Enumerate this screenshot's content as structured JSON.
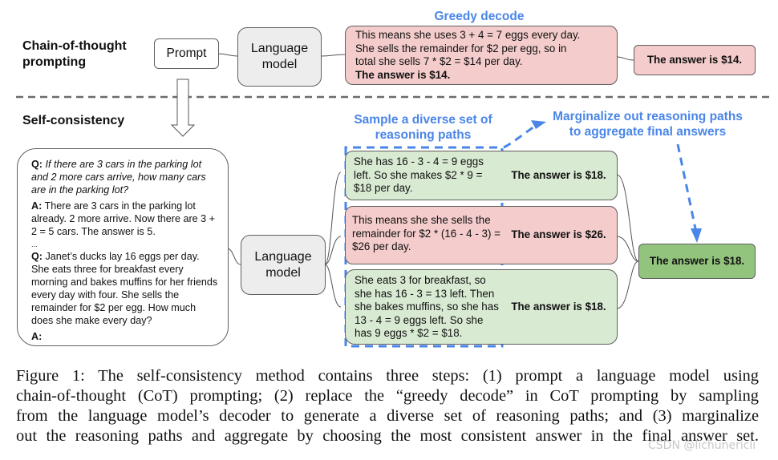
{
  "top": {
    "section_label_line1": "Chain-of-thought",
    "section_label_line2": "prompting",
    "prompt_box": "Prompt",
    "lm_line1": "Language",
    "lm_line2": "model",
    "greedy_title": "Greedy decode",
    "greedy_text": [
      "This means she uses 3 + 4 = 7 eggs every day.",
      "She sells the remainder for $2 per egg, so in",
      "total she sells 7 * $2 = $14 per day."
    ],
    "greedy_answer_inline": "The answer is $14.",
    "greedy_answer_box": "The answer is $14."
  },
  "bottom": {
    "section_label": "Self-consistency",
    "prompt": {
      "q1_label": "Q:",
      "q1_text": "If there are 3 cars in the parking lot and 2 more cars arrive, how many cars are in the parking lot?",
      "a1_label": "A:",
      "a1_text": "There are 3 cars in the parking lot already. 2 more arrive. Now there are 3 + 2 = 5 cars. The answer is 5.",
      "ellipsis": "...",
      "q2_label": "Q:",
      "q2_text": "Janet’s ducks lay 16 eggs per day. She eats three for breakfast every morning and bakes muffins for her friends every day with four. She sells the remainder for $2 per egg. How much does she make every day?",
      "a2_label": "A:"
    },
    "lm_line1": "Language",
    "lm_line2": "model",
    "sample_title_line1": "Sample a diverse set of",
    "sample_title_line2": "reasoning paths",
    "marginalize_title_line1": "Marginalize out reasoning paths",
    "marginalize_title_line2": "to aggregate final answers",
    "paths": [
      {
        "reasoning": "She has 16 - 3 - 4 = 9 eggs left. So she makes $2 * 9 = $18 per day.",
        "answer": "The answer is $18.",
        "status": "correct",
        "color": "#d9ead3"
      },
      {
        "reasoning": "This means she she sells the remainder for $2 * (16 - 4 - 3) = $26 per day.",
        "answer": "The answer is $26.",
        "status": "incorrect",
        "color": "#f4cccc"
      },
      {
        "reasoning": "She eats 3 for breakfast, so she has 16 - 3 = 13 left. Then she bakes muffins, so she has 13 - 4 = 9 eggs left. So she has 9 eggs * $2 = $18.",
        "answer": "The answer is $18.",
        "status": "correct",
        "color": "#d9ead3"
      }
    ],
    "final_answer": "The answer is $18.",
    "final_color": "#93c47d"
  },
  "colors": {
    "accent_blue": "#4a86e8",
    "incorrect_pink": "#f4cccc",
    "correct_light_green": "#d9ead3",
    "final_green": "#93c47d",
    "model_gray": "#ededed"
  },
  "caption": {
    "lines": [
      "Figure 1: The self-consistency method contains three steps: (1) prompt a language model using",
      "chain-of-thought (CoT) prompting; (2) replace the “greedy decode” in CoT prompting by sampling",
      "from the language model’s decoder to generate a diverse set of reasoning paths; and (3) marginalize",
      "out the reasoning paths and aggregate by choosing the most consistent answer in the final answer set."
    ]
  },
  "watermark": "CSDN @lichunericli"
}
